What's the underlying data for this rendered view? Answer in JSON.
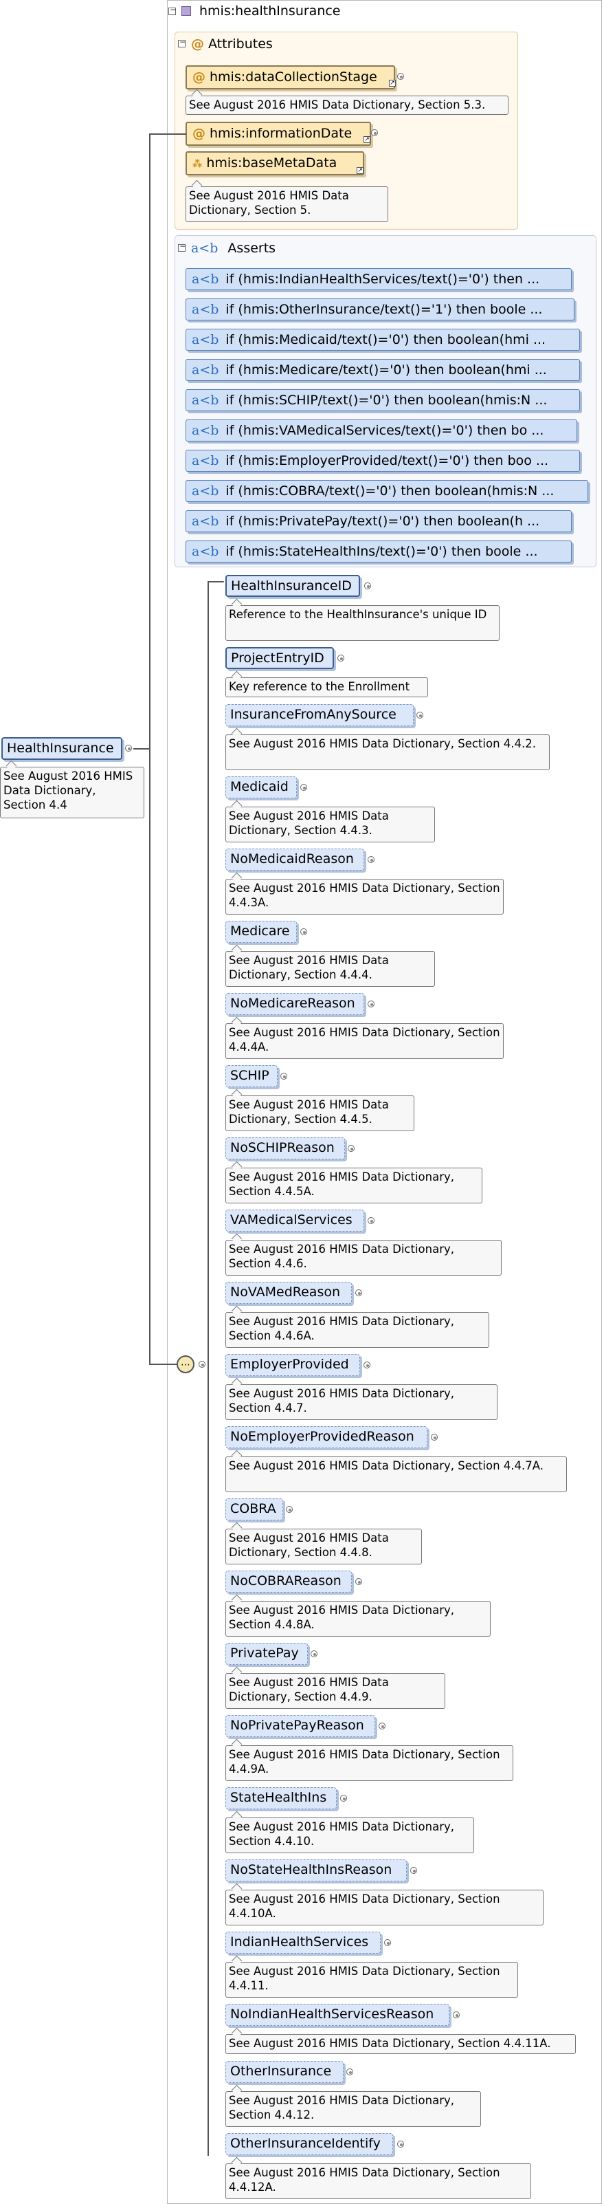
{
  "root": {
    "label": "hmis:healthInsurance"
  },
  "attributes": {
    "header": "Attributes",
    "items": [
      {
        "name": "hmis:dataCollectionStage",
        "doc": "See August 2016 HMIS Data Dictionary, Section 5.3."
      },
      {
        "name": "hmis:informationDate",
        "doc": ""
      },
      {
        "name": "hmis:baseMetaData",
        "doc": "See August 2016 HMIS Data Dictionary, Section 5."
      }
    ]
  },
  "asserts": {
    "header": "Asserts",
    "prefix": "a<b",
    "items": [
      "if (hmis:IndianHealthServices/text()='0') then ...",
      "if (hmis:OtherInsurance/text()='1') then boole ...",
      "if (hmis:Medicaid/text()='0') then boolean(hmi ...",
      "if (hmis:Medicare/text()='0') then boolean(hmi ...",
      "if (hmis:SCHIP/text()='0') then boolean(hmis:N ...",
      "if (hmis:VAMedicalServices/text()='0') then bo ...",
      "if (hmis:EmployerProvided/text()='0') then boo ...",
      "if (hmis:COBRA/text()='0') then boolean(hmis:N ...",
      "if (hmis:PrivatePay/text()='0') then boolean(h ...",
      "if (hmis:StateHealthIns/text()='0') then boole ..."
    ]
  },
  "element": {
    "name": "HealthInsurance",
    "doc": "See August 2016 HMIS Data Dictionary, Section 4.4"
  },
  "children": [
    {
      "name": "HealthInsuranceID",
      "doc": "Reference to the HealthInsurance's unique ID"
    },
    {
      "name": "ProjectEntryID",
      "doc": "Key reference to the Enrollment"
    },
    {
      "name": "InsuranceFromAnySource",
      "doc": "See August 2016 HMIS Data Dictionary, Section 4.4.2."
    },
    {
      "name": "Medicaid",
      "doc": "See August 2016 HMIS Data Dictionary, Section 4.4.3."
    },
    {
      "name": "NoMedicaidReason",
      "doc": "See August 2016 HMIS Data Dictionary, Section 4.4.3A."
    },
    {
      "name": "Medicare",
      "doc": "See August 2016 HMIS Data Dictionary, Section 4.4.4."
    },
    {
      "name": "NoMedicareReason",
      "doc": "See August 2016 HMIS Data Dictionary, Section 4.4.4A."
    },
    {
      "name": "SCHIP",
      "doc": "See August 2016 HMIS Data Dictionary, Section 4.4.5."
    },
    {
      "name": "NoSCHIPReason",
      "doc": "See August 2016 HMIS Data Dictionary, Section 4.4.5A."
    },
    {
      "name": "VAMedicalServices",
      "doc": "See August 2016 HMIS Data Dictionary, Section 4.4.6."
    },
    {
      "name": "NoVAMedReason",
      "doc": "See August 2016 HMIS Data Dictionary, Section 4.4.6A."
    },
    {
      "name": "EmployerProvided",
      "doc": "See August 2016 HMIS Data Dictionary, Section 4.4.7."
    },
    {
      "name": "NoEmployerProvidedReason",
      "doc": "See August 2016 HMIS Data Dictionary, Section 4.4.7A."
    },
    {
      "name": "COBRA",
      "doc": "See August 2016 HMIS Data Dictionary, Section 4.4.8."
    },
    {
      "name": "NoCOBRAReason",
      "doc": "See August 2016 HMIS Data Dictionary, Section 4.4.8A."
    },
    {
      "name": "PrivatePay",
      "doc": "See August 2016 HMIS Data Dictionary, Section 4.4.9."
    },
    {
      "name": "NoPrivatePayReason",
      "doc": "See August 2016 HMIS Data Dictionary, Section 4.4.9A."
    },
    {
      "name": "StateHealthIns",
      "doc": "See August 2016 HMIS Data Dictionary, Section 4.4.10."
    },
    {
      "name": "NoStateHealthInsReason",
      "doc": "See August 2016 HMIS Data Dictionary, Section 4.4.10A."
    },
    {
      "name": "IndianHealthServices",
      "doc": "See August 2016 HMIS Data Dictionary, Section 4.4.11."
    },
    {
      "name": "NoIndianHealthServicesReason",
      "doc": "See August 2016 HMIS Data Dictionary, Section 4.4.11A."
    },
    {
      "name": "OtherInsurance",
      "doc": "See August 2016 HMIS Data Dictionary, Section 4.4.12."
    },
    {
      "name": "OtherInsuranceIdentify",
      "doc": "See August 2016 HMIS Data Dictionary, Section 4.4.12A."
    }
  ]
}
